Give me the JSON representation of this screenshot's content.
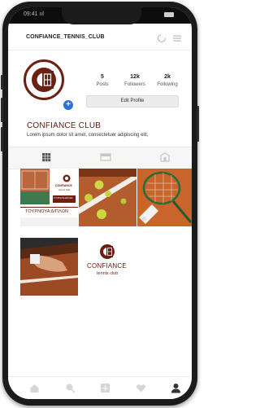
{
  "status_bar": {
    "time": "09:41  ııl"
  },
  "header": {
    "username": "CONFIANCE_TENNIS_CLUB"
  },
  "profile": {
    "stats": [
      {
        "value": "5",
        "label": "Posts"
      },
      {
        "value": "12k",
        "label": "Followers"
      },
      {
        "value": "2k",
        "label": "Following"
      }
    ],
    "edit_label": "Edit Profile",
    "name": "CONFIANCE CLUB",
    "bio": "Lorem ipsum dolor sit amet, consectetuer adipiscing elit,"
  },
  "posts": {
    "poster": {
      "brand": "CONFIANCE",
      "club": "tennis club",
      "side_text": "ΤΟΥΡΝΟΥΑ ΔΙΠΛΩΝ",
      "bottom_text": "ΤΟΥΡΝΟΥΑ ΔΙΠΛΩΝ"
    },
    "logo_post": {
      "brand": "CONFIANCE",
      "club": "tennis club"
    }
  },
  "colors": {
    "brand": "#6b2112",
    "name": "#5c1a10",
    "clay": "#c9642b",
    "accent_blue": "#2e6fd8"
  },
  "icons": {
    "header": [
      "loading-icon",
      "menu-icon"
    ],
    "tabs": [
      "grid-icon",
      "list-icon",
      "tagged-icon"
    ],
    "nav": [
      "home-icon",
      "search-icon",
      "add-icon",
      "heart-icon",
      "profile-icon"
    ]
  }
}
